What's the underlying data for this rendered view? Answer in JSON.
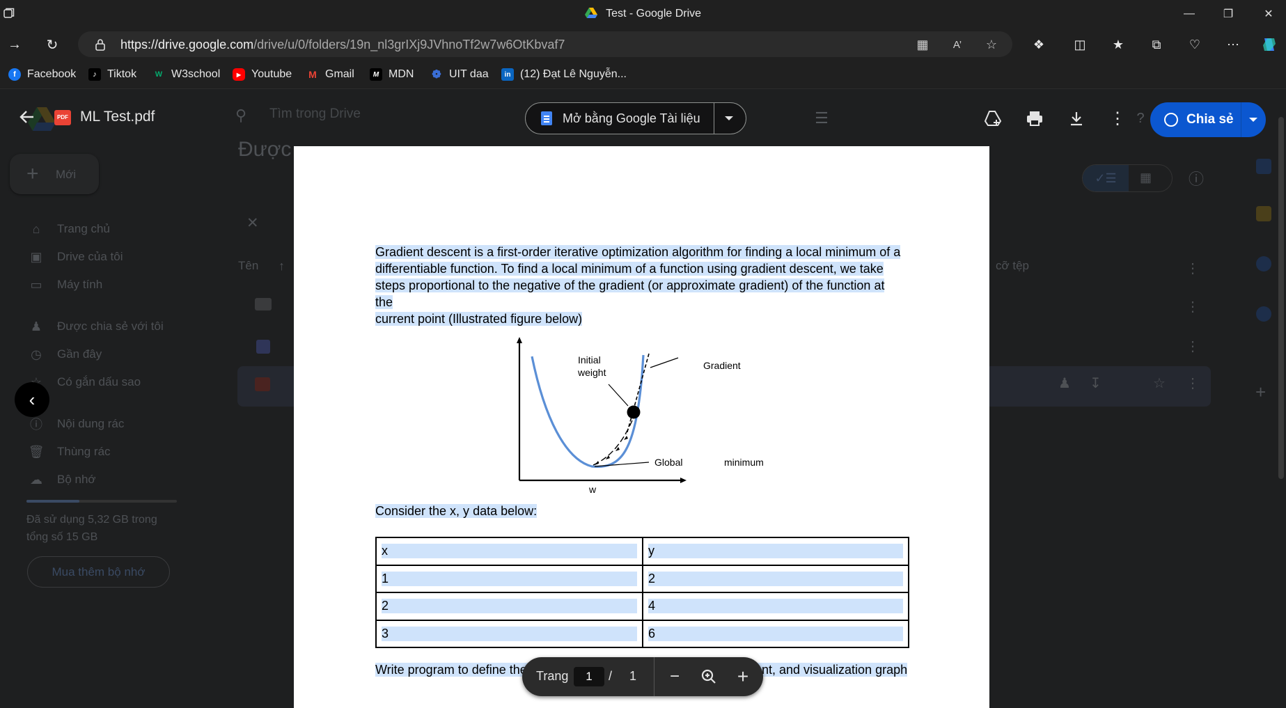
{
  "browser": {
    "tab_title": "Test - Google Drive",
    "url_domain": "https://drive.google.com",
    "url_path": "/drive/u/0/folders/19n_nl3grIXj9JVhnoTf2w7w6OtKbvaf7",
    "bookmarks": [
      {
        "label": "Facebook",
        "icon": "facebook-icon",
        "color": "#1877f2"
      },
      {
        "label": "Tiktok",
        "icon": "tiktok-icon",
        "color": "#000000"
      },
      {
        "label": "W3school",
        "icon": "w3school-icon",
        "color": "#04aa6d"
      },
      {
        "label": "Youtube",
        "icon": "youtube-icon",
        "color": "#ff0000"
      },
      {
        "label": "Gmail",
        "icon": "gmail-icon",
        "color": "#ea4335"
      },
      {
        "label": "MDN",
        "icon": "mdn-icon",
        "color": "#000000"
      },
      {
        "label": "UIT daa",
        "icon": "uit-icon",
        "color": "#3a6ed6"
      },
      {
        "label": "(12) Đạt Lê Nguyễn...",
        "icon": "linkedin-icon",
        "color": "#0a66c2"
      }
    ]
  },
  "drive": {
    "new_button": "Mới",
    "search_placeholder": "Tìm trong Drive",
    "page_heading": "Được",
    "sidebar": [
      {
        "label": "Trang chủ",
        "icon": "home-icon"
      },
      {
        "label": "Drive của tôi",
        "icon": "my-drive-icon"
      },
      {
        "label": "Máy tính",
        "icon": "computer-icon"
      },
      {
        "label": "Được chia sẻ với tôi",
        "icon": "shared-icon"
      },
      {
        "label": "Gần đây",
        "icon": "recent-icon"
      },
      {
        "label": "Có gắn dấu sao",
        "icon": "star-icon"
      },
      {
        "label": "Nội dung rác",
        "icon": "spam-icon"
      },
      {
        "label": "Thùng rác",
        "icon": "trash-icon"
      },
      {
        "label": "Bộ nhớ",
        "icon": "cloud-icon"
      }
    ],
    "storage_text": "Đã sử dụng 5,32 GB trong tổng số 15 GB",
    "storage_fraction": 0.35,
    "buy_storage": "Mua thêm bộ nhớ",
    "column_name": "Tên",
    "column_size": "cỡ tệp"
  },
  "viewer": {
    "file_name": "ML Test.pdf",
    "open_with": "Mở bằng Google Tài liệu",
    "share": "Chia sẻ",
    "page_label": "Trang",
    "current_page": "1",
    "slash": "/",
    "total_pages": "1",
    "accent_color": "#0b57d0"
  },
  "pdf": {
    "paragraph_lines": [
      "Gradient descent is a first-order iterative optimization algorithm for finding a local minimum of a",
      "differentiable function. To find a local minimum of a function using gradient descent, we take",
      "steps proportional to the negative of the gradient (or approximate gradient) of the function at the",
      "current point (Illustrated figure below)"
    ],
    "figure": {
      "label_initial_weight_1": "Initial",
      "label_initial_weight_2": "weight",
      "label_gradient": "Gradient",
      "label_global": "Global",
      "label_minimum": "minimum",
      "label_axis_w": "w"
    },
    "consider": "Consider the x, y data below:",
    "table": {
      "headers": [
        "x",
        "y"
      ],
      "rows": [
        [
          "1",
          "2"
        ],
        [
          "2",
          "4"
        ],
        [
          "3",
          "6"
        ]
      ]
    },
    "write_line": "Write program to define the data, model, loss function, gradient descent, and visualization graph"
  }
}
